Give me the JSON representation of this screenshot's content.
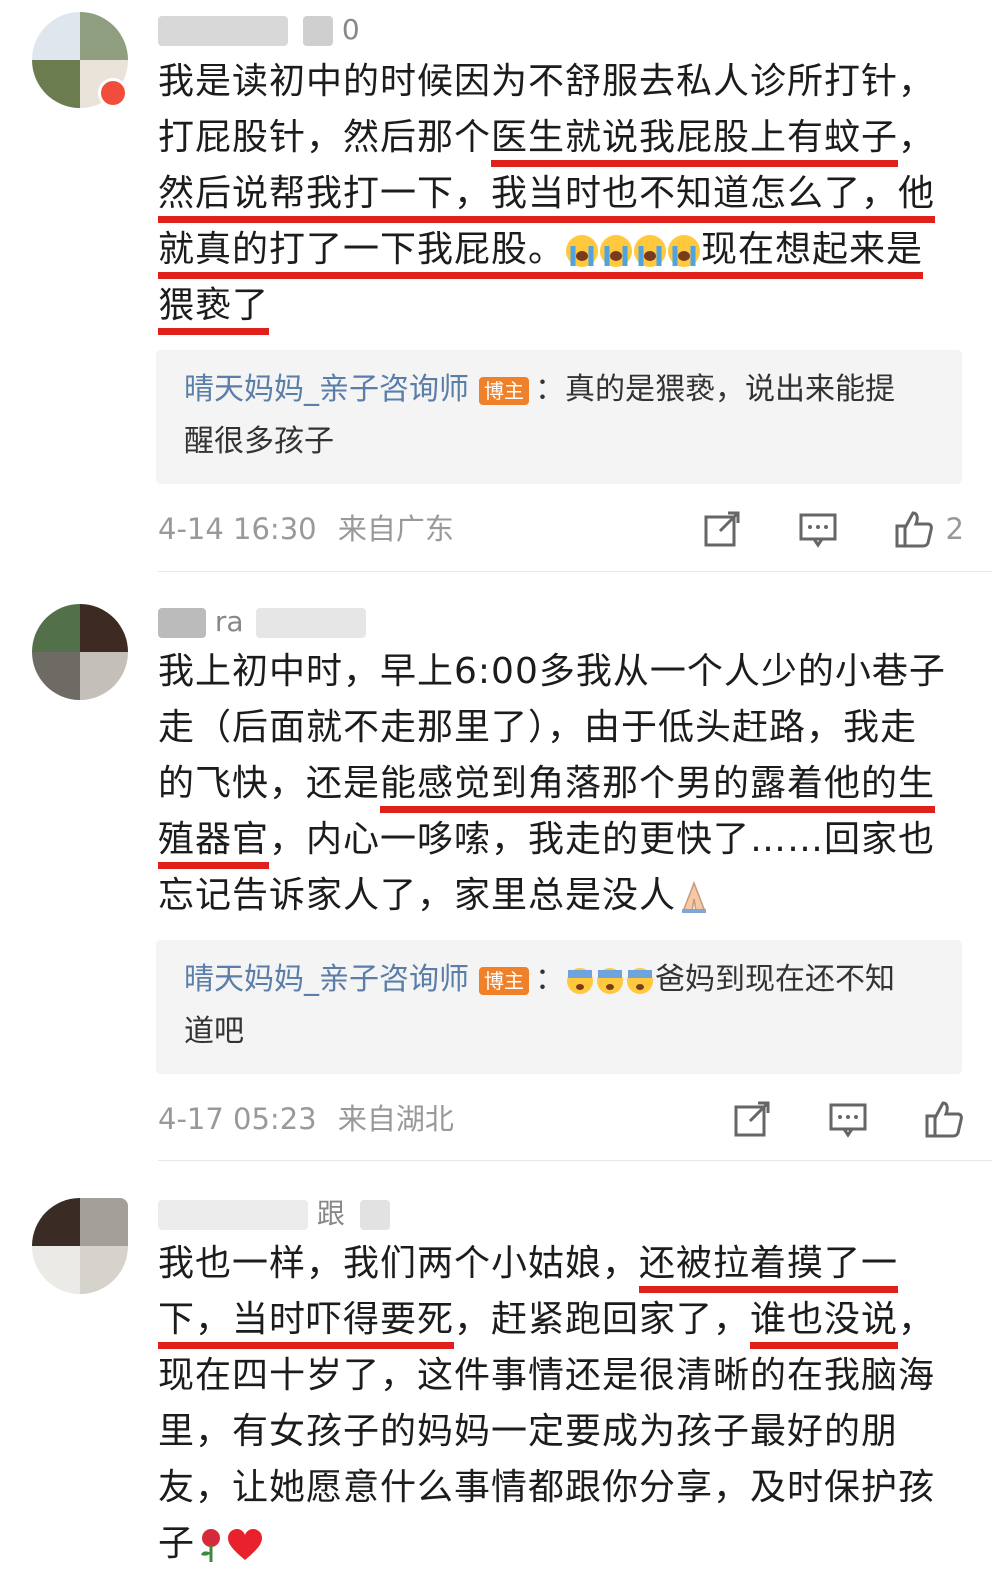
{
  "comments": [
    {
      "username_visible": "0",
      "line1": "我是读初中的时候因为不舒服去私人诊所打针，",
      "line2_a": "打屁股针，然后那个",
      "line2_u": "医生就说我屁股上有蚊子",
      "line2_b": "，",
      "line3_u": "然后说帮我打一下，我当时也不知道怎么了，他",
      "line4_u": "就真的打了一下我屁股。",
      "line4_emoji": [
        "loudly-crying-face",
        "loudly-crying-face",
        "loudly-crying-face",
        "loudly-crying-face"
      ],
      "line4_b": "现在想起来是",
      "line5_u": "猥亵了",
      "reply": {
        "author": "晴天妈妈_亲子咨询师",
        "badge": "博主",
        "colon": "：",
        "text_line1": "真的是猥亵，说出来能提",
        "text_line2": "醒很多孩子"
      },
      "meta": {
        "date": "4-14 16:30",
        "location": "来自广东",
        "like_count": "2"
      }
    },
    {
      "username_visible": "ra",
      "line1": "我上初中时，早上6:00多我从一个人少的小巷子",
      "line2": "走（后面就不走那里了），由于低头赶路，我走",
      "line3_a": "的飞快，还是",
      "line3_u": "能感觉到角落那个男的露着他的生",
      "line4_u": "殖器官",
      "line4_b": "，内心一哆嗦，我走的更快了……回家也",
      "line5": "忘记告诉家人了，家里总是没人",
      "line5_emoji": "folded-hands",
      "reply": {
        "author": "晴天妈妈_亲子咨询师",
        "badge": "博主",
        "colon": "：",
        "emoji": [
          "cold-sweat-face",
          "cold-sweat-face",
          "cold-sweat-face"
        ],
        "text_line1": "爸妈到现在还不知",
        "text_line2": "道吧"
      },
      "meta": {
        "date": "4-17 05:23",
        "location": "来自湖北"
      }
    },
    {
      "username_visible": "跟",
      "line1_a": "我也一样，我们两个小姑娘，",
      "line1_u": "还被拉着摸了一",
      "line2_u": "下，当时吓得要死",
      "line2_b": "，赶紧跑回家了，",
      "line2_u2": "谁也没说",
      "line2_c": "，",
      "line3": "现在四十岁了，这件事情还是很清晰的在我脑海",
      "line4": "里，有女孩子的妈妈一定要成为孩子最好的朋",
      "line5": "友，让她愿意什么事情都跟你分享，及时保护孩",
      "line6": "子",
      "line6_emoji": [
        "rose",
        "red-heart"
      ]
    }
  ],
  "icons": [
    "share-icon",
    "comment-icon",
    "like-icon"
  ],
  "colors": {
    "underline": "#e0201a",
    "reply_author": "#5a7ea8",
    "badge": "#f0812b",
    "meta": "#999999"
  }
}
